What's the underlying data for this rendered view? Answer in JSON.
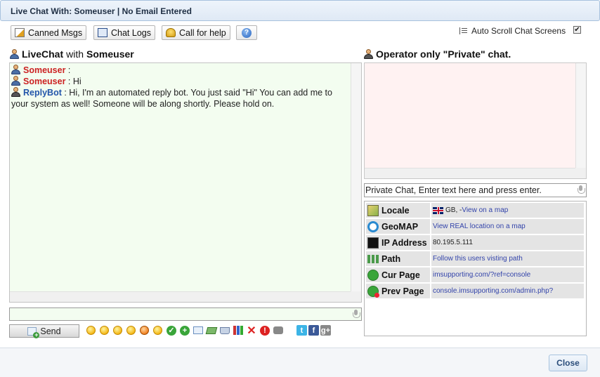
{
  "window": {
    "title": "Live Chat With: Someuser | No Email Entered"
  },
  "toolbar": {
    "canned_label": "Canned Msgs",
    "logs_label": "Chat Logs",
    "call_label": "Call for help",
    "help_icon": "question-icon",
    "autoscroll_label": "Auto Scroll Chat Screens",
    "autoscroll_checked": true
  },
  "livechat": {
    "heading_prefix": "LiveChat",
    "heading_with": "with",
    "heading_user": "Someuser",
    "messages": [
      {
        "sender": "Someuser",
        "sep": " :",
        "text": ""
      },
      {
        "sender": "Someuser",
        "sep": " : ",
        "text": "Hi"
      },
      {
        "sender": "ReplyBot",
        "sep": " : ",
        "text": "Hi, I'm an automated reply bot. You just said \"Hi\" You can add me to your system as well! Someone will be along shortly. Please hold on."
      }
    ],
    "input_value": "",
    "send_label": "Send"
  },
  "operator": {
    "heading": "Operator only \"Private\" chat.",
    "input_value": "Private Chat, Enter text here and press enter."
  },
  "visitor_info": {
    "rows": [
      {
        "key": "Locale",
        "country": "GB, - ",
        "value": "View on a map",
        "icon": "map-icon"
      },
      {
        "key": "GeoMAP",
        "value": "View REAL location on a map",
        "icon": "globe-icon"
      },
      {
        "key": "IP Address",
        "value": "80.195.5.111",
        "icon": "terminal-icon"
      },
      {
        "key": "Path",
        "value": "Follow this users visting path",
        "icon": "path-icon"
      },
      {
        "key": "Cur Page",
        "value": "imsupporting.com/?ref=console",
        "icon": "current-page-icon"
      },
      {
        "key": "Prev Page",
        "value": "console.imsupporting.com/admin.php?",
        "icon": "previous-page-icon"
      }
    ]
  },
  "footer": {
    "close_label": "Close"
  },
  "colors": {
    "chat_bg": "#f3fdf0",
    "private_bg": "#fff2f2",
    "user_name": "#cc2222",
    "bot_name": "#2255aa"
  }
}
